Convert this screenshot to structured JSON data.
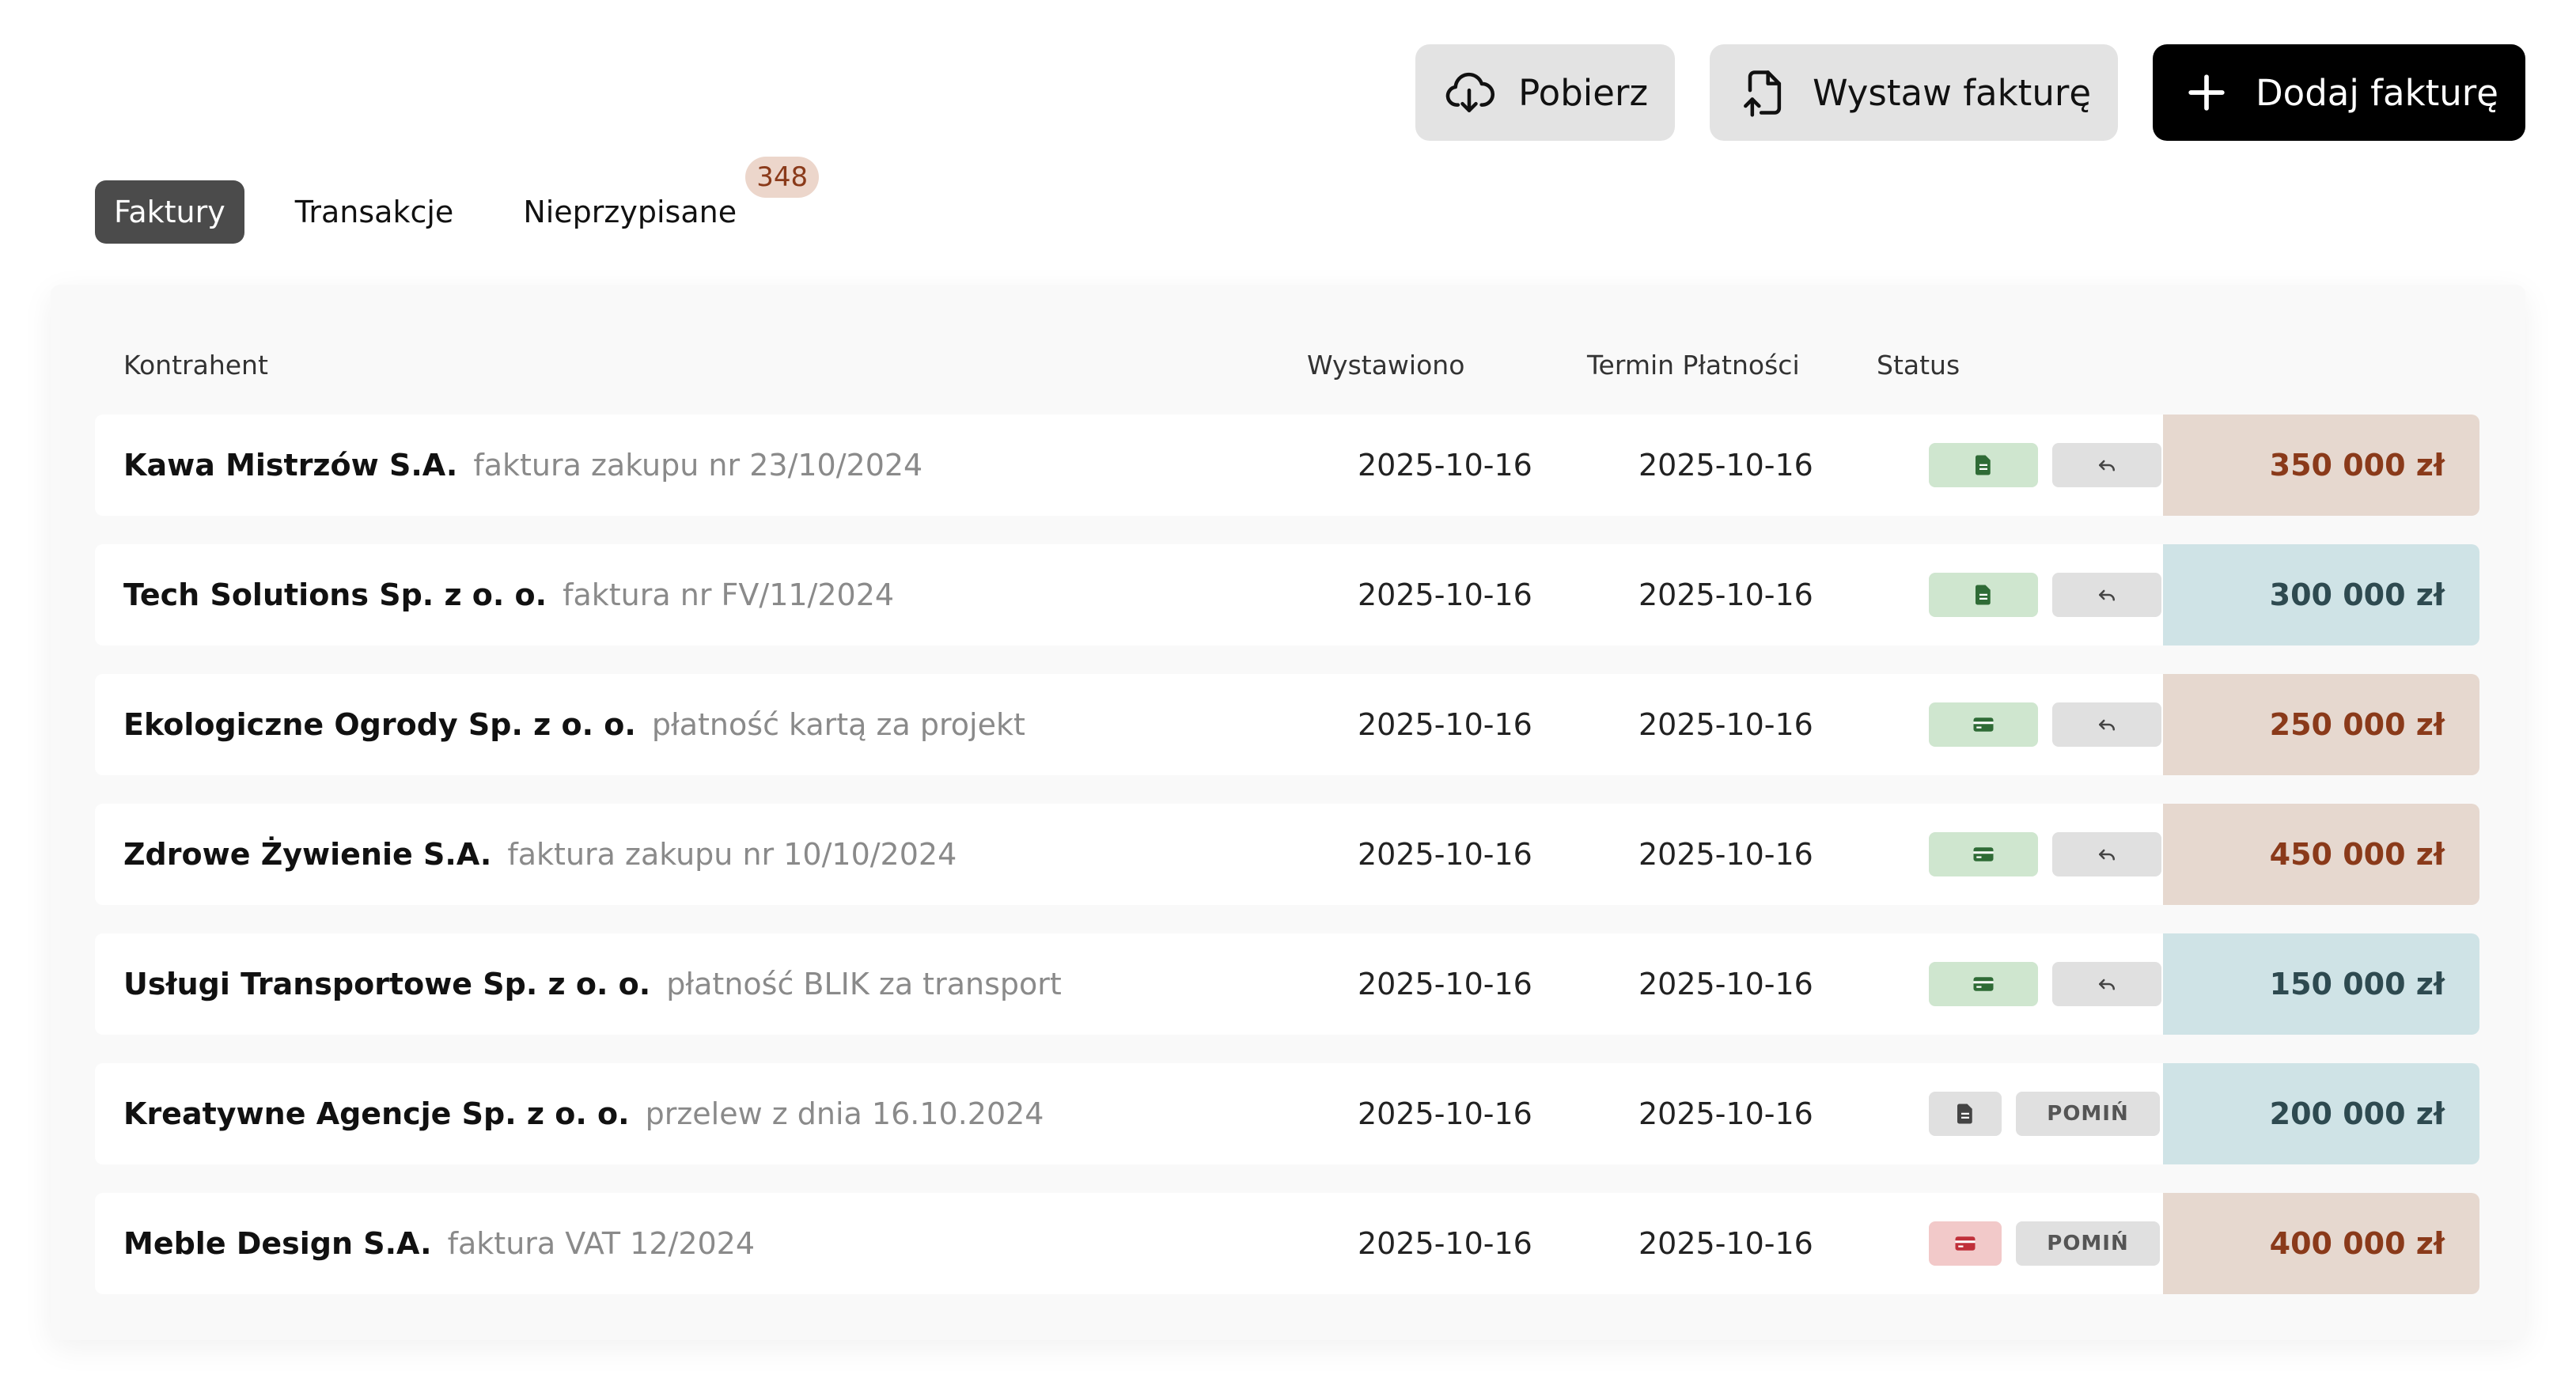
{
  "toolbar": {
    "download_label": "Pobierz",
    "issue_label": "Wystaw fakturę",
    "add_label": "Dodaj fakturę"
  },
  "tabs": [
    {
      "label": "Faktury",
      "active": true
    },
    {
      "label": "Transakcje",
      "active": false
    },
    {
      "label": "Nieprzypisane",
      "active": false,
      "badge": "348"
    }
  ],
  "table": {
    "headers": {
      "contractor": "Kontrahent",
      "issued": "Wystawiono",
      "due": "Termin Płatności",
      "status": "Status"
    },
    "rows": [
      {
        "name": "Kawa Mistrzów S.A.",
        "desc": "faktura zakupu nr 23/10/2024",
        "issued": "2025-10-16",
        "due": "2025-10-16",
        "status_icon": "document-icon",
        "status_color": "green",
        "action": "undo-icon",
        "amount": "350 000 zł",
        "amount_tone": "brown"
      },
      {
        "name": "Tech Solutions Sp. z o. o.",
        "desc": "faktura nr FV/11/2024",
        "issued": "2025-10-16",
        "due": "2025-10-16",
        "status_icon": "document-icon",
        "status_color": "green",
        "action": "undo-icon",
        "amount": "300 000 zł",
        "amount_tone": "teal"
      },
      {
        "name": "Ekologiczne Ogrody Sp. z o. o.",
        "desc": "płatność kartą za projekt",
        "issued": "2025-10-16",
        "due": "2025-10-16",
        "status_icon": "card-icon",
        "status_color": "green",
        "action": "undo-icon",
        "amount": "250 000 zł",
        "amount_tone": "brown"
      },
      {
        "name": "Zdrowe Żywienie S.A.",
        "desc": "faktura zakupu nr 10/10/2024",
        "issued": "2025-10-16",
        "due": "2025-10-16",
        "status_icon": "card-icon",
        "status_color": "green",
        "action": "undo-icon",
        "amount": "450 000 zł",
        "amount_tone": "brown"
      },
      {
        "name": "Usługi Transportowe Sp. z o. o.",
        "desc": "płatność BLIK za transport",
        "issued": "2025-10-16",
        "due": "2025-10-16",
        "status_icon": "card-icon",
        "status_color": "green",
        "action": "undo-icon",
        "amount": "150 000 zł",
        "amount_tone": "teal"
      },
      {
        "name": "Kreatywne Agencje Sp. z o. o.",
        "desc": "przelew z dnia 16.10.2024",
        "issued": "2025-10-16",
        "due": "2025-10-16",
        "status_icon": "document-icon",
        "status_color": "gray",
        "action": "skip",
        "skip_label": "POMIŃ",
        "amount": "200 000 zł",
        "amount_tone": "teal"
      },
      {
        "name": "Meble Design S.A.",
        "desc": "faktura VAT 12/2024",
        "issued": "2025-10-16",
        "due": "2025-10-16",
        "status_icon": "card-icon",
        "status_color": "red",
        "action": "skip",
        "skip_label": "POMIŃ",
        "amount": "400 000 zł",
        "amount_tone": "brown"
      }
    ]
  },
  "colors": {
    "green": "#cfe6cf",
    "red": "#f2c9c9",
    "brown_bg": "#e6d8cf",
    "brown_fg": "#8a3a1a",
    "teal_bg": "#cfe3e6",
    "teal_fg": "#2e4a50"
  }
}
